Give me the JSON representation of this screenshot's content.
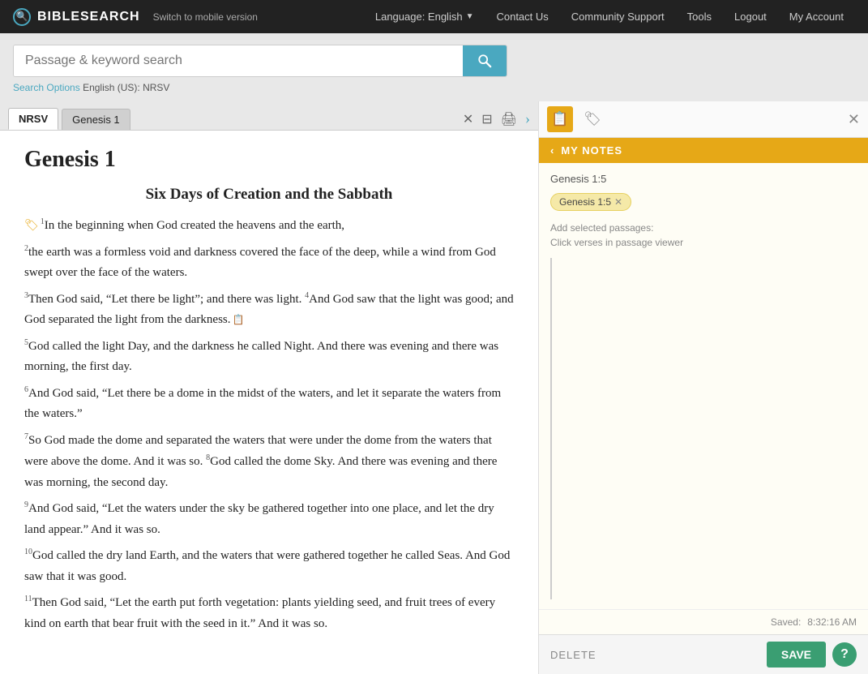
{
  "topnav": {
    "logo": "BIBLESEARCH",
    "switch_mobile": "Switch to mobile version",
    "language_label": "Language: English",
    "nav_links": [
      {
        "id": "contact",
        "label": "Contact Us"
      },
      {
        "id": "community",
        "label": "Community Support"
      },
      {
        "id": "tools",
        "label": "Tools"
      },
      {
        "id": "logout",
        "label": "Logout"
      },
      {
        "id": "account",
        "label": "My Account"
      }
    ]
  },
  "search": {
    "placeholder": "Passage & keyword search",
    "options_link": "Search Options",
    "options_detail": "English (US): NRSV"
  },
  "tabs": [
    {
      "id": "nrsv",
      "label": "NRSV",
      "active": true
    },
    {
      "id": "genesis1",
      "label": "Genesis 1",
      "active": false
    }
  ],
  "passage": {
    "title": "Genesis 1",
    "subtitle": "Six Days of Creation and the Sabbath",
    "verses": [
      {
        "num": "1",
        "text": "In the beginning when God created the heavens and the earth,",
        "has_tag": true
      },
      {
        "num": "2",
        "text": "the earth was a formless void and darkness covered the face of the deep, while a wind from God swept over the face of the waters."
      },
      {
        "num": "3",
        "text": "Then God said, “Let there be light”; and there was light."
      },
      {
        "num": "4",
        "text": "And God saw that the light was good; and God separated the light from the darkness.",
        "has_note": true
      },
      {
        "num": "5",
        "text": "God called the light Day, and the darkness he called Night. And there was evening and there was morning, the first day."
      },
      {
        "num": "6",
        "text": "And God said, “Let there be a dome in the midst of the waters, and let it separate the waters from the waters.”"
      },
      {
        "num": "7",
        "text": "So God made the dome and separated the waters that were under the dome from the waters that were above the dome. And it was so."
      },
      {
        "num": "8",
        "text": "God called the dome Sky. And there was evening and there was morning, the second day."
      },
      {
        "num": "9",
        "text": "And God said, “Let the waters under the sky be gathered together into one place, and let the dry land appear.” And it was so."
      },
      {
        "num": "10",
        "text": "God called the dry land Earth, and the waters that were gathered together he called Seas. And God saw that it was good."
      },
      {
        "num": "11",
        "text": "Then God said, “Let the earth put forth vegetation: plants yielding seed, and fruit trees of every kind on earth that bear fruit with the seed in it.” And it was so."
      }
    ]
  },
  "notes_panel": {
    "header": "MY NOTES",
    "reference": "Genesis 1:5",
    "tag": "Genesis 1:5",
    "add_passages_label": "Add selected passages:",
    "click_verses_label": "Click verses in passage viewer",
    "textarea_value": "",
    "saved_text": "Saved:",
    "saved_time": "8:32:16 AM",
    "delete_label": "DELETE",
    "save_label": "SAVE"
  }
}
